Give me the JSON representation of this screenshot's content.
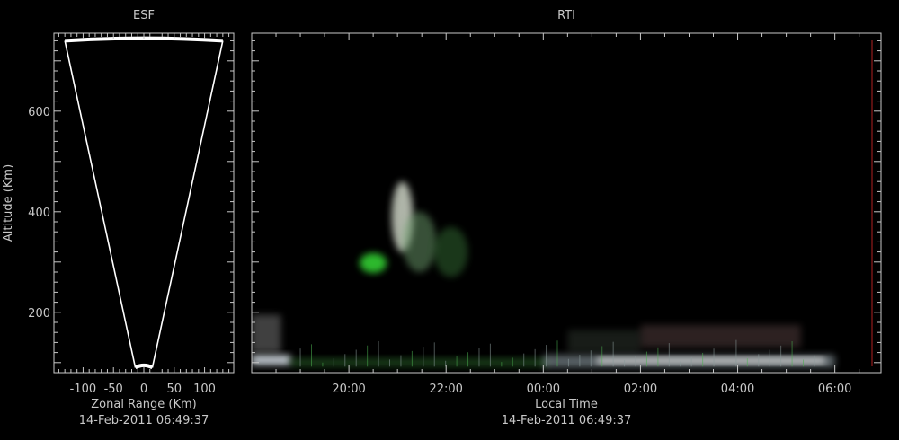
{
  "chart_data": [
    {
      "type": "heatmap",
      "title": "ESF",
      "xlabel": "Zonal Range (Km)",
      "ylabel": "Altitude (Km)",
      "footer": "14-Feb-2011 06:49:37",
      "xlim": [
        -148,
        148
      ],
      "ylim": [
        80,
        755
      ],
      "x_ticks": [
        -100,
        -50,
        0,
        50,
        100
      ],
      "x_tick_labels": [
        "-100",
        "-50",
        "0",
        "50",
        "100"
      ],
      "y_ticks": [
        200,
        400,
        600
      ],
      "y_tick_labels": [
        "200",
        "400",
        "600"
      ],
      "beam": {
        "apex_altitude": 90,
        "top_altitude": 745,
        "half_width_top": 130,
        "half_width_bottom": 14
      },
      "line_color": "#ffffff"
    },
    {
      "type": "heatmap",
      "title": "RTI",
      "xlabel": "Local Time",
      "footer": "14-Feb-2011 06:49:37",
      "xlim_hours": [
        18.0,
        30.95
      ],
      "ylim": [
        80,
        755
      ],
      "x_ticks_hours": [
        20,
        22,
        24,
        26,
        28,
        30
      ],
      "x_tick_labels": [
        "20:00",
        "22:00",
        "00:00",
        "02:00",
        "04:00",
        "06:00"
      ],
      "y_ticks": [
        200,
        400,
        600
      ],
      "y_tick_labels": [
        "200",
        "400",
        "600"
      ],
      "echoes": [
        {
          "t0": 18.0,
          "t1": 18.8,
          "alt0": 95,
          "alt1": 115,
          "color": "#dfe8f0",
          "opacity": 0.85
        },
        {
          "t0": 18.0,
          "t1": 18.6,
          "alt0": 120,
          "alt1": 195,
          "color": "#b8b8b8",
          "opacity": 0.35
        },
        {
          "t0": 18.8,
          "t1": 24.1,
          "alt0": 92,
          "alt1": 108,
          "color": "#3a8a3a",
          "opacity": 0.45
        },
        {
          "t0": 24.0,
          "t1": 30.0,
          "alt0": 90,
          "alt1": 115,
          "color": "#a0b0b8",
          "opacity": 0.55
        },
        {
          "t0": 25.1,
          "t1": 29.8,
          "alt0": 98,
          "alt1": 110,
          "color": "#f0f0f0",
          "opacity": 0.8
        },
        {
          "t0": 26.0,
          "t1": 29.3,
          "alt0": 130,
          "alt1": 175,
          "color": "#806060",
          "opacity": 0.35
        },
        {
          "t0": 24.5,
          "t1": 26.0,
          "alt0": 120,
          "alt1": 165,
          "color": "#607060",
          "opacity": 0.25
        }
      ],
      "plumes": [
        {
          "t": 21.1,
          "alt": 390,
          "rx_h": 0.22,
          "ry_alt": 70,
          "color": "#e8f0e0",
          "opacity": 0.75
        },
        {
          "t": 21.45,
          "alt": 340,
          "rx_h": 0.35,
          "ry_alt": 60,
          "color": "#6fa06f",
          "opacity": 0.5
        },
        {
          "t": 20.5,
          "alt": 298,
          "rx_h": 0.28,
          "ry_alt": 20,
          "color": "#33cc33",
          "opacity": 0.9
        },
        {
          "t": 22.1,
          "alt": 320,
          "rx_h": 0.35,
          "ry_alt": 50,
          "color": "#3a7a3a",
          "opacity": 0.45
        }
      ],
      "streaks": [
        {
          "t": 20.95,
          "alt0": 330,
          "alt1": 470,
          "color": "#d0e0c0"
        },
        {
          "t": 21.25,
          "alt0": 340,
          "alt1": 540,
          "color": "#e0e8d8"
        },
        {
          "t": 21.55,
          "alt0": 310,
          "alt1": 430,
          "color": "#90c090"
        },
        {
          "t": 21.85,
          "alt0": 300,
          "alt1": 420,
          "color": "#80b080"
        },
        {
          "t": 22.1,
          "alt0": 280,
          "alt1": 410,
          "color": "#709a70"
        },
        {
          "t": 22.45,
          "alt0": 270,
          "alt1": 360,
          "color": "#5a8a5a"
        },
        {
          "t": 22.75,
          "alt0": 280,
          "alt1": 330,
          "color": "#4a7a4a"
        },
        {
          "t": 24.5,
          "alt0": 120,
          "alt1": 190,
          "color": "#3a6a3a"
        },
        {
          "t": 25.2,
          "alt0": 290,
          "alt1": 350,
          "color": "#606060"
        }
      ],
      "right_border_color": "#b02020"
    }
  ]
}
